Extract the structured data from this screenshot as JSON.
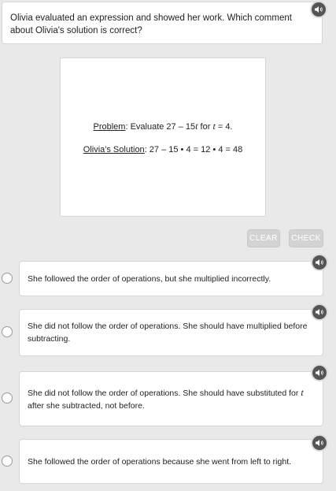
{
  "question": {
    "text": "Olivia evaluated an expression and showed her work. Which comment about Olivia's solution is correct?"
  },
  "problem": {
    "problem_label": "Problem",
    "problem_text_1": ": Evaluate 27 – 15",
    "problem_var": "t",
    "problem_text_2": " for ",
    "problem_var_2": "t",
    "problem_text_3": " = 4.",
    "solution_label": "Olivia's Solution",
    "solution_text": ": 27 – 15 • 4 = 12 • 4 = 48"
  },
  "buttons": {
    "clear_label": "CLEAR",
    "check_label": "CHECK"
  },
  "choices": [
    {
      "text": "She followed the order of operations, but she multiplied incorrectly."
    },
    {
      "text": "She did not follow the order of operations. She should have multiplied before subtracting."
    },
    {
      "text_before": "She did not follow the order of operations. She should have substituted for ",
      "var": "t",
      "text_after": " after she subtracted, not before."
    },
    {
      "text": "She followed the order of operations because she went from left to right."
    }
  ],
  "icons": {
    "audio": "speaker-icon",
    "radio": "radio-button"
  },
  "colors": {
    "background": "#e9e9e9",
    "card": "#ffffff",
    "button_disabled": "#d3d3d3",
    "audio_button": "#555555"
  }
}
